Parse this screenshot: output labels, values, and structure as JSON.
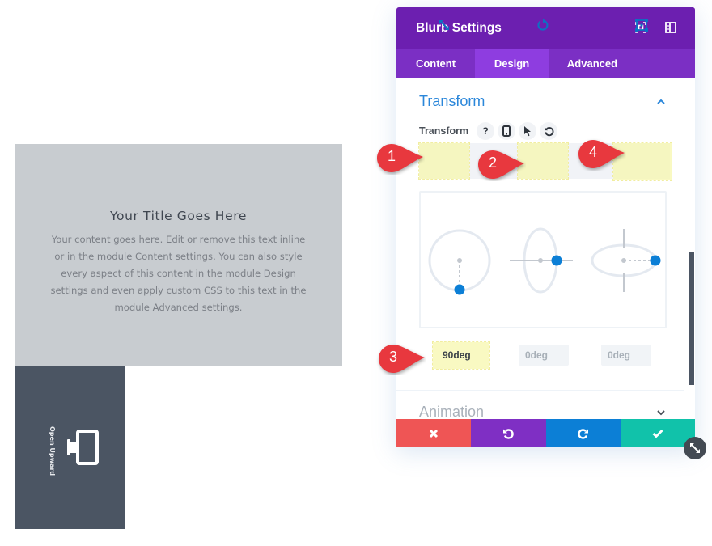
{
  "canvas": {
    "blurb": {
      "title": "Your Title Goes Here",
      "body": "Your content goes here. Edit or remove this text inline or in the module Content settings. You can also style every aspect of this content in the module Design settings and even apply custom CSS to this text in the module Advanced settings."
    },
    "rotated_module": {
      "label": "Open Upward",
      "icon": "monitor-icon"
    }
  },
  "panel": {
    "title": "Blurb Settings",
    "header_icons": [
      "fullscreen-icon",
      "sidebar-toggle-icon"
    ],
    "tabs": [
      {
        "label": "Content",
        "active": false
      },
      {
        "label": "Design",
        "active": true
      },
      {
        "label": "Advanced",
        "active": false
      }
    ],
    "section": {
      "title": "Transform",
      "expanded": true,
      "field_label": "Transform",
      "field_tools": [
        "help-icon",
        "responsive-phone-icon",
        "hover-cursor-icon",
        "reset-icon"
      ],
      "transform_tabs": [
        "scale-icon",
        "translate-icon",
        "rotate-icon",
        "skew-icon",
        "origin-icon"
      ],
      "rotate_values": [
        {
          "axis": "Z",
          "value": "90deg",
          "active": true
        },
        {
          "axis": "X",
          "value": "0deg",
          "active": false
        },
        {
          "axis": "Y",
          "value": "0deg",
          "active": false
        }
      ]
    },
    "collapsed_section": {
      "title": "Animation",
      "expanded": false
    },
    "footer": [
      {
        "action": "discard",
        "icon": "close-icon",
        "color": "#ef5555"
      },
      {
        "action": "undo",
        "icon": "undo-icon",
        "color": "#7f2fc4"
      },
      {
        "action": "redo",
        "icon": "redo-icon",
        "color": "#0c7fd6"
      },
      {
        "action": "save",
        "icon": "check-icon",
        "color": "#11c2aa"
      }
    ]
  },
  "annotations": [
    {
      "number": "1",
      "target": "scale-tab"
    },
    {
      "number": "2",
      "target": "rotate-tab"
    },
    {
      "number": "3",
      "target": "rotate-z-input"
    },
    {
      "number": "4",
      "target": "origin-tab"
    }
  ],
  "colors": {
    "header": "#6c1fb0",
    "tabs": "#7b2fc4",
    "active_tab": "#8e3de0",
    "accent_blue": "#2b87da",
    "marker_red": "#e8383e",
    "highlight": "#f6f6aa"
  }
}
